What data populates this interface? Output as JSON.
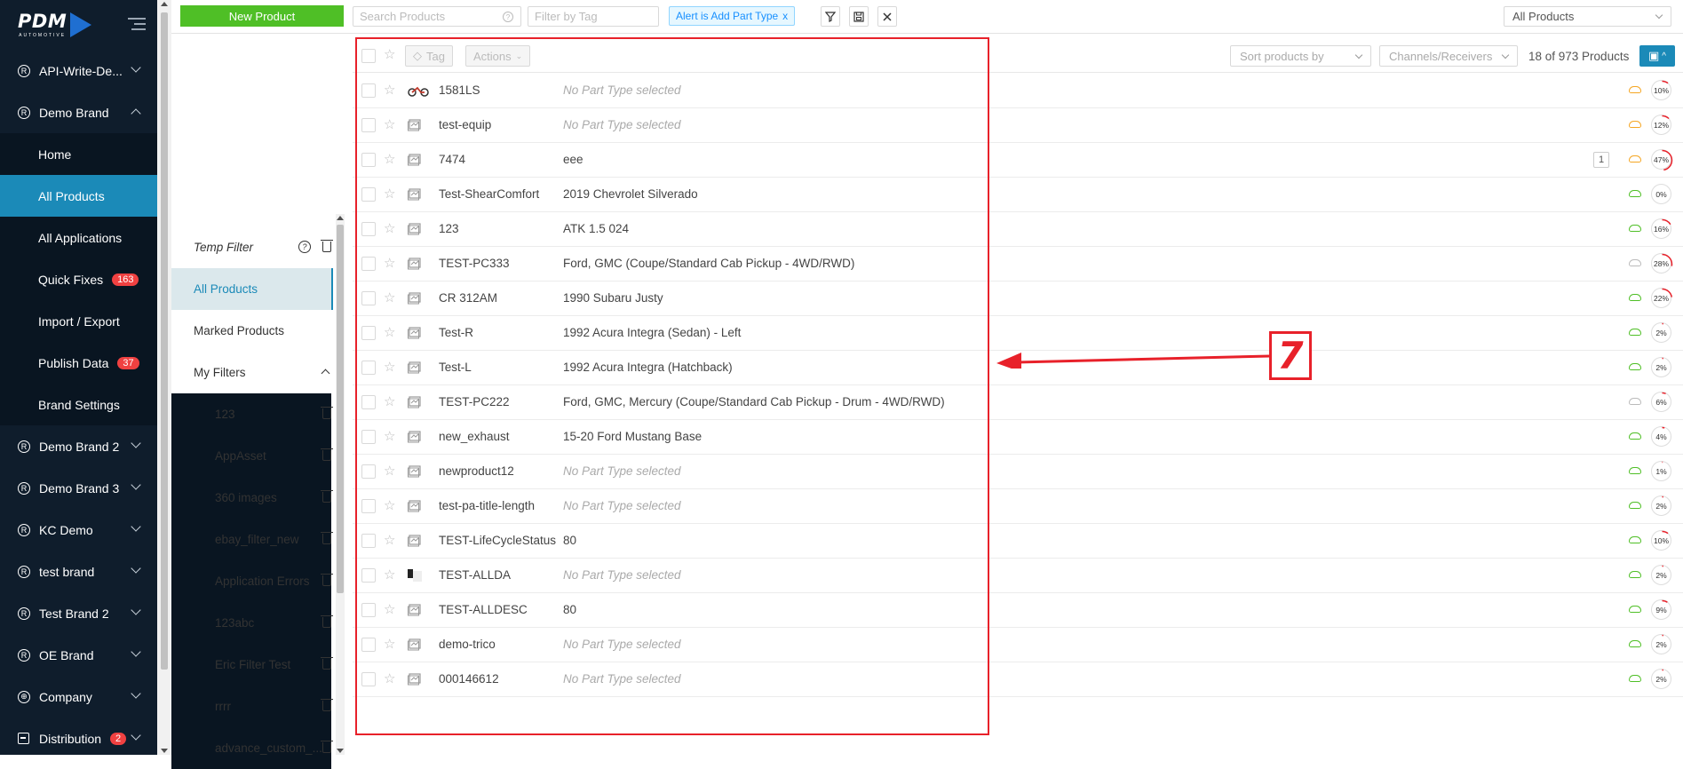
{
  "nav": {
    "logo_text": "PDM",
    "logo_sub": "AUTOMOTIVE",
    "items": [
      {
        "label": "API-Write-De...",
        "type": "brand",
        "chevron": "down"
      },
      {
        "label": "Demo Brand",
        "type": "brand",
        "chevron": "up"
      },
      {
        "label": "Demo Brand 2",
        "type": "brand",
        "chevron": "down"
      },
      {
        "label": "Demo Brand 3",
        "type": "brand",
        "chevron": "down"
      },
      {
        "label": "KC Demo",
        "type": "brand",
        "chevron": "down"
      },
      {
        "label": "test brand",
        "type": "brand",
        "chevron": "down"
      },
      {
        "label": "Test Brand 2",
        "type": "brand",
        "chevron": "down"
      },
      {
        "label": "OE Brand",
        "type": "brand",
        "chevron": "down"
      },
      {
        "label": "Company",
        "type": "globe",
        "chevron": "down"
      },
      {
        "label": "Distribution",
        "type": "square",
        "chevron": "down",
        "badge": "2"
      }
    ],
    "sub_items": [
      {
        "label": "Home"
      },
      {
        "label": "All Products",
        "active": true
      },
      {
        "label": "All Applications"
      },
      {
        "label": "Quick Fixes",
        "badge": "163"
      },
      {
        "label": "Import / Export"
      },
      {
        "label": "Publish Data",
        "badge": "37"
      },
      {
        "label": "Brand Settings"
      }
    ]
  },
  "topbar": {
    "new_product": "New Product",
    "search_placeholder": "Search Products",
    "tag_placeholder": "Filter by Tag",
    "alert_tag": "Alert is Add Part Type",
    "alert_close": "x",
    "view_select": "All Products"
  },
  "filters": {
    "temp": "Temp Filter",
    "all": "All Products",
    "marked": "Marked Products",
    "my": "My Filters",
    "saved": [
      "123",
      "AppAsset",
      "360 images",
      "ebay_filter_new",
      "Application Errors",
      "123abc",
      "Eric Filter Test",
      "rrrr",
      "advance_custom_..."
    ]
  },
  "products_header": {
    "tag": "Tag",
    "actions": "Actions",
    "sort": "Sort products by",
    "channels": "Channels/Receivers",
    "count": "18 of 973 Products"
  },
  "products": [
    {
      "pn": "1581LS",
      "pt": "No Part Type selected",
      "none": true,
      "cloud": "orange",
      "pct": "10%",
      "p": 10,
      "thumb": "bike"
    },
    {
      "pn": "test-equip",
      "pt": "No Part Type selected",
      "none": true,
      "cloud": "orange",
      "pct": "12%",
      "p": 12
    },
    {
      "pn": "7474",
      "pt": "eee",
      "cloud": "orange",
      "pct": "47%",
      "p": 47,
      "count": "1"
    },
    {
      "pn": "Test-ShearComfort",
      "pt": "2019 Chevrolet Silverado",
      "cloud": "green",
      "pct": "0%",
      "p": 0
    },
    {
      "pn": "123",
      "pt": "ATK 1.5 024",
      "cloud": "green",
      "pct": "16%",
      "p": 16
    },
    {
      "pn": "TEST-PC333",
      "pt": "Ford, GMC (Coupe/Standard Cab Pickup - 4WD/RWD)",
      "cloud": "gray",
      "pct": "28%",
      "p": 28
    },
    {
      "pn": "CR 312AM",
      "pt": "1990 Subaru Justy",
      "cloud": "green",
      "pct": "22%",
      "p": 22
    },
    {
      "pn": "Test-R",
      "pt": "1992 Acura Integra (Sedan) - Left",
      "cloud": "green",
      "pct": "2%",
      "p": 2
    },
    {
      "pn": "Test-L",
      "pt": "1992 Acura Integra (Hatchback)",
      "cloud": "green",
      "pct": "2%",
      "p": 2
    },
    {
      "pn": "TEST-PC222",
      "pt": "Ford, GMC, Mercury (Coupe/Standard Cab Pickup - Drum - 4WD/RWD)",
      "cloud": "gray",
      "pct": "6%",
      "p": 6
    },
    {
      "pn": "new_exhaust",
      "pt": "15-20 Ford Mustang Base",
      "cloud": "green",
      "pct": "4%",
      "p": 4
    },
    {
      "pn": "newproduct12",
      "pt": "No Part Type selected",
      "none": true,
      "cloud": "green",
      "pct": "1%",
      "p": 1
    },
    {
      "pn": "test-pa-title-length",
      "pt": "No Part Type selected",
      "none": true,
      "cloud": "green",
      "pct": "2%",
      "p": 2
    },
    {
      "pn": "TEST-LifeCycleStatus",
      "pt": "80",
      "cloud": "green",
      "pct": "10%",
      "p": 10
    },
    {
      "pn": "TEST-ALLDA",
      "pt": "No Part Type selected",
      "none": true,
      "cloud": "green",
      "pct": "2%",
      "p": 2,
      "thumb": "block"
    },
    {
      "pn": "TEST-ALLDESC",
      "pt": "80",
      "cloud": "green",
      "pct": "9%",
      "p": 9
    },
    {
      "pn": "demo-trico",
      "pt": "No Part Type selected",
      "none": true,
      "cloud": "green",
      "pct": "2%",
      "p": 2
    },
    {
      "pn": "000146612",
      "pt": "No Part Type selected",
      "none": true,
      "cloud": "green",
      "pct": "2%",
      "p": 2
    }
  ],
  "annotation": {
    "number": "7",
    "color": "#e8212a"
  },
  "colors": {
    "nav_bg": "#0f1d2c",
    "active": "#1b8ab8",
    "green": "#4fbf26",
    "badge": "#f04141"
  }
}
